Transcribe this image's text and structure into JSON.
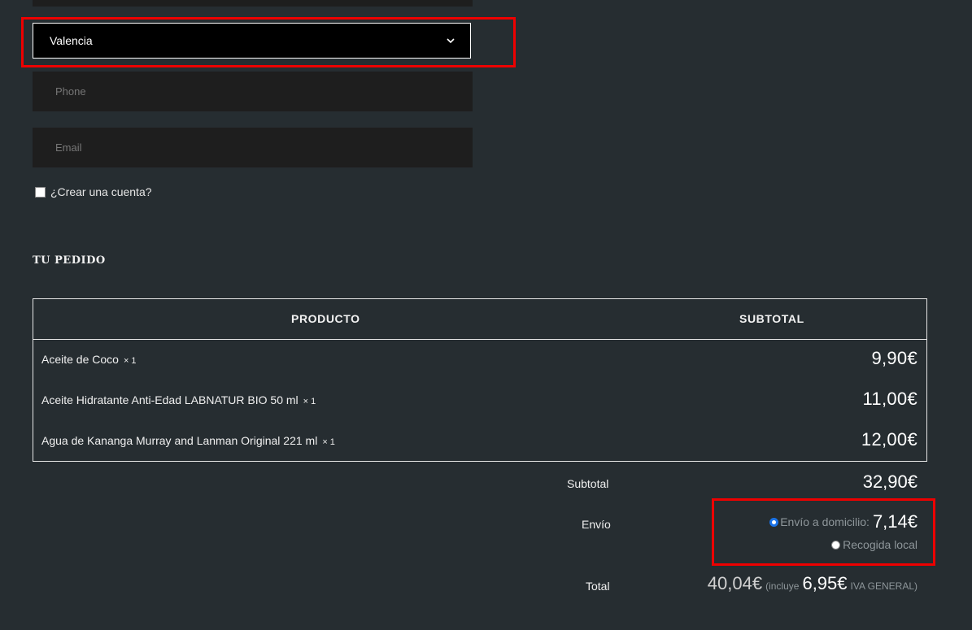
{
  "form": {
    "state_value": "Valencia",
    "phone_placeholder": "Phone",
    "email_placeholder": "Email",
    "create_account_label": "¿Crear una cuenta?"
  },
  "order": {
    "title": "TU PEDIDO",
    "col_product": "PRODUCTO",
    "col_subtotal": "SUBTOTAL",
    "items": [
      {
        "name": "Aceite de Coco",
        "qty": "× 1",
        "price": "9,90€"
      },
      {
        "name": "Aceite Hidratante Anti-Edad LABNATUR BIO 50 ml",
        "qty": "× 1",
        "price": "11,00€"
      },
      {
        "name": "Agua de Kananga Murray and Lanman Original 221 ml",
        "qty": "× 1",
        "price": "12,00€"
      }
    ],
    "subtotal_label": "Subtotal",
    "subtotal_value": "32,90€",
    "shipping_label": "Envío",
    "shipping_option_home": "Envío a domicilio:",
    "shipping_home_price": "7,14€",
    "shipping_option_pickup": "Recogida local",
    "total_label": "Total",
    "total_value": "40,04€",
    "tax_prefix": "(incluye",
    "tax_value": "6,95€",
    "tax_suffix": "IVA GENERAL)"
  },
  "colors": {
    "background": "#262d31",
    "field": "#1e1e1e",
    "highlight": "#e00000",
    "radio_selected": "#1a73e8"
  }
}
